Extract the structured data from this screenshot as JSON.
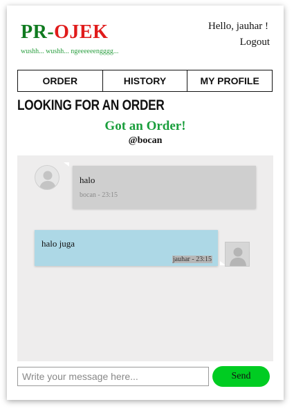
{
  "brand": {
    "pr": "PR",
    "dash": "-",
    "ojek": "OJEK",
    "tagline": "wushh... wushh... ngeeeeeengggg..."
  },
  "user": {
    "greeting": "Hello, jauhar !",
    "logout": "Logout"
  },
  "tabs": [
    {
      "label": "ORDER"
    },
    {
      "label": "HISTORY"
    },
    {
      "label": "MY PROFILE"
    }
  ],
  "page": {
    "title": "LOOKING FOR AN ORDER",
    "status": "Got an Order!",
    "customer": "@bocan"
  },
  "chat": {
    "messages": [
      {
        "direction": "incoming",
        "text": "halo",
        "meta": "bocan - 23:15"
      },
      {
        "direction": "outgoing",
        "text": "halo juga",
        "meta": "jauhar - 23:15"
      }
    ],
    "input": {
      "placeholder": "Write your message here...",
      "value": ""
    },
    "send_label": "Send"
  },
  "colors": {
    "brand_green": "#0f7a1f",
    "brand_red": "#e01b1b",
    "status_green": "#1a9e3c",
    "send_button": "#00cc22",
    "outgoing_bubble": "#add8e6",
    "incoming_bubble": "#cfcfcf"
  }
}
